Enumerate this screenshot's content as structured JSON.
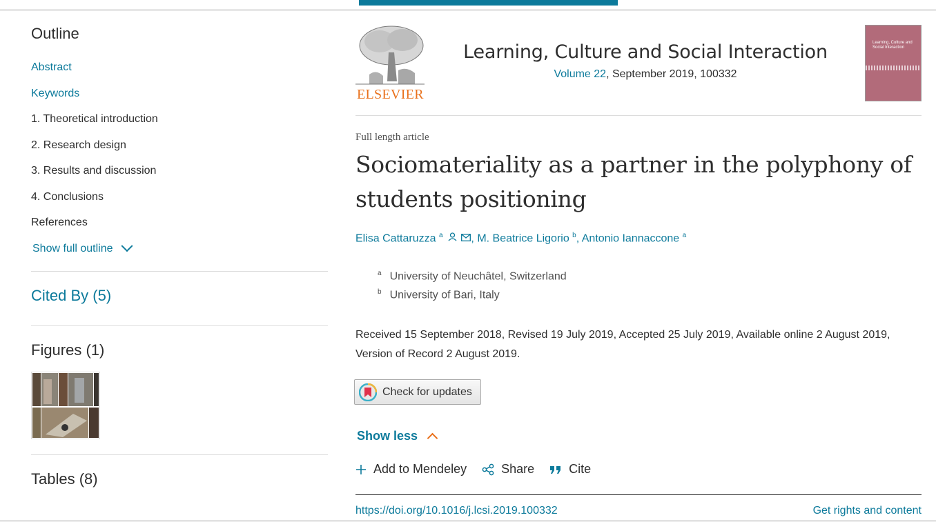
{
  "sidebar": {
    "outline_title": "Outline",
    "items": [
      {
        "label": "Abstract",
        "link": true
      },
      {
        "label": "Keywords",
        "link": true
      },
      {
        "label": "1. Theoretical introduction",
        "link": false
      },
      {
        "label": "2. Research design",
        "link": false
      },
      {
        "label": "3. Results and discussion",
        "link": false
      },
      {
        "label": "4. Conclusions",
        "link": false
      },
      {
        "label": "References",
        "link": false
      }
    ],
    "show_full_outline": "Show full outline",
    "cited_by": "Cited By (5)",
    "figures": "Figures (1)",
    "tables": "Tables (8)"
  },
  "header": {
    "publisher": "ELSEVIER",
    "journal_title": "Learning, Culture and Social Interaction",
    "volume_link": "Volume 22",
    "volume_rest": ", September 2019, 100332",
    "cover_title": "Learning, Culture and Social Interaction"
  },
  "article": {
    "type": "Full length article",
    "title": "Sociomateriality as a partner in the polyphony of students positioning",
    "authors": [
      {
        "name": "Elisa Cattaruzza",
        "sup": "a"
      },
      {
        "name": "M. Beatrice Ligorio",
        "sup": "b"
      },
      {
        "name": "Antonio Iannaccone",
        "sup": "a"
      }
    ],
    "affiliations": [
      {
        "sup": "a",
        "text": "University of Neuchâtel, Switzerland"
      },
      {
        "sup": "b",
        "text": "University of Bari, Italy"
      }
    ],
    "dates": "Received 15 September 2018, Revised 19 July 2019, Accepted 25 July 2019, Available online 2 August 2019, Version of Record 2 August 2019.",
    "check_updates": "Check for updates",
    "show_less": "Show less",
    "actions": {
      "mendeley": "Add to Mendeley",
      "share": "Share",
      "cite": "Cite"
    },
    "doi": "https://doi.org/10.1016/j.lcsi.2019.100332",
    "rights": "Get rights and content"
  },
  "colors": {
    "link": "#0c7a9b",
    "accent_orange": "#e9711c",
    "text": "#2e2e2e"
  }
}
